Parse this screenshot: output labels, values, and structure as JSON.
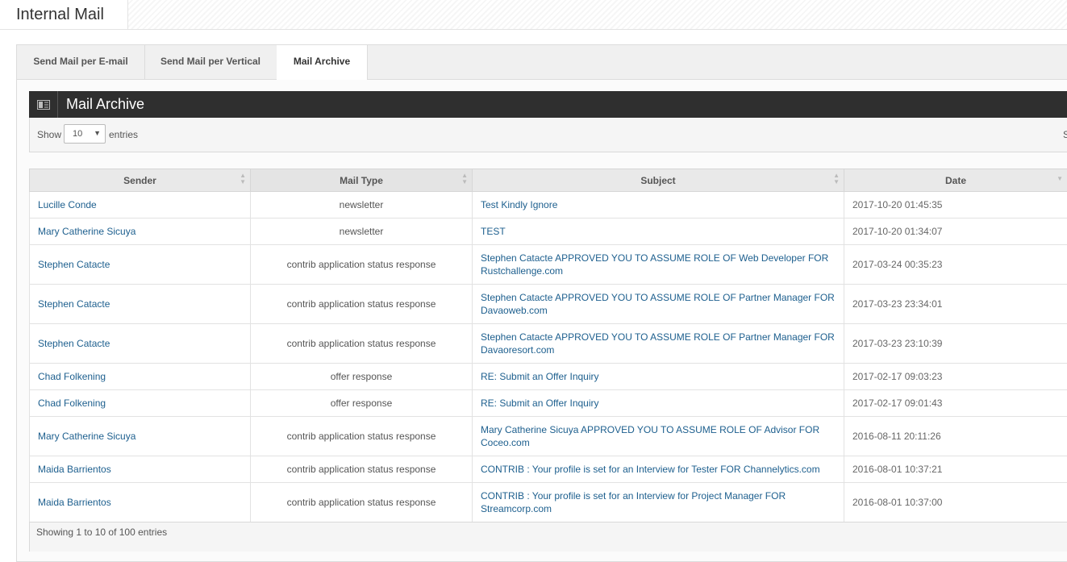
{
  "page": {
    "title": "Internal Mail"
  },
  "tabs": [
    {
      "label": "Send Mail per E-mail"
    },
    {
      "label": "Send Mail per Vertical"
    },
    {
      "label": "Mail Archive"
    }
  ],
  "widget": {
    "title": "Mail Archive",
    "icon": "list-icon"
  },
  "length_control": {
    "show_label": "Show",
    "value": "10",
    "entries_label": "entries"
  },
  "search": {
    "label_fragment": "S"
  },
  "table": {
    "headers": [
      "Sender",
      "Mail Type",
      "Subject",
      "Date"
    ],
    "rows": [
      {
        "sender": "Lucille Conde",
        "type": "newsletter",
        "subject": "Test Kindly Ignore",
        "date": "2017-10-20 01:45:35"
      },
      {
        "sender": "Mary Catherine Sicuya",
        "type": "newsletter",
        "subject": "TEST",
        "date": "2017-10-20 01:34:07"
      },
      {
        "sender": "Stephen Catacte",
        "type": "contrib application status response",
        "subject": "Stephen Catacte APPROVED YOU TO ASSUME ROLE OF Web Developer FOR Rustchallenge.com",
        "date": "2017-03-24 00:35:23"
      },
      {
        "sender": "Stephen Catacte",
        "type": "contrib application status response",
        "subject": "Stephen Catacte APPROVED YOU TO ASSUME ROLE OF Partner Manager FOR Davaoweb.com",
        "date": "2017-03-23 23:34:01"
      },
      {
        "sender": "Stephen Catacte",
        "type": "contrib application status response",
        "subject": "Stephen Catacte APPROVED YOU TO ASSUME ROLE OF Partner Manager FOR Davaoresort.com",
        "date": "2017-03-23 23:10:39"
      },
      {
        "sender": "Chad Folkening",
        "type": "offer response",
        "subject": "RE: Submit an Offer Inquiry",
        "date": "2017-02-17 09:03:23"
      },
      {
        "sender": "Chad Folkening",
        "type": "offer response",
        "subject": "RE: Submit an Offer Inquiry",
        "date": "2017-02-17 09:01:43"
      },
      {
        "sender": "Mary Catherine Sicuya",
        "type": "contrib application status response",
        "subject": "Mary Catherine Sicuya APPROVED YOU TO ASSUME ROLE OF Advisor FOR Coceo.com",
        "date": "2016-08-11 20:11:26"
      },
      {
        "sender": "Maida Barrientos",
        "type": "contrib application status response",
        "subject": "CONTRIB : Your profile is set for an Interview for Tester FOR Channelytics.com",
        "date": "2016-08-01 10:37:21"
      },
      {
        "sender": "Maida Barrientos",
        "type": "contrib application status response",
        "subject": "CONTRIB : Your profile is set for an Interview for Project Manager FOR Streamcorp.com",
        "date": "2016-08-01 10:37:00"
      }
    ]
  },
  "footer": {
    "info": "Showing 1 to 10 of 100 entries"
  }
}
